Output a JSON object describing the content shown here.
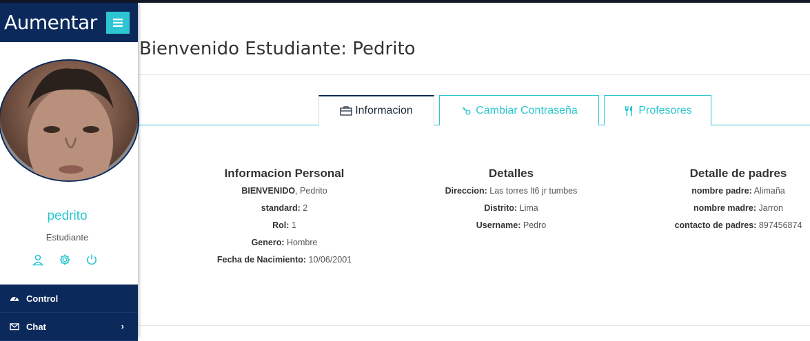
{
  "brand": {
    "name": "Aumentar"
  },
  "profile": {
    "name": "pedrito",
    "role": "Estudiante"
  },
  "nav": {
    "items": [
      {
        "label": "Control"
      },
      {
        "label": "Chat"
      }
    ]
  },
  "page": {
    "title": "Bienvenido Estudiante: Pedrito"
  },
  "tabs": [
    {
      "label": "Informacion",
      "active": true
    },
    {
      "label": "Cambiar Contraseña",
      "active": false
    },
    {
      "label": "Profesores",
      "active": false
    }
  ],
  "personal": {
    "heading": "Informacion Personal",
    "rows": [
      {
        "label": "BIENVENIDO",
        "value": ", Pedrito"
      },
      {
        "label": "standard:",
        "value": " 2"
      },
      {
        "label": "Rol:",
        "value": " 1"
      },
      {
        "label": "Genero:",
        "value": " Hombre"
      },
      {
        "label": "Fecha de Nacimiento:",
        "value": " 10/06/2001"
      }
    ]
  },
  "detalles": {
    "heading": "Detalles",
    "rows": [
      {
        "label": "Direccion:",
        "value": " Las torres lt6 jr tumbes"
      },
      {
        "label": "Distrito:",
        "value": " Lima"
      },
      {
        "label": "Username:",
        "value": " Pedro"
      }
    ]
  },
  "padres": {
    "heading": "Detalle de padres",
    "rows": [
      {
        "label": "nombre padre:",
        "value": " Alimaña"
      },
      {
        "label": "nombre madre:",
        "value": " Jarron"
      },
      {
        "label": "contacto de padres:",
        "value": " 897456874"
      }
    ]
  },
  "colors": {
    "navy": "#0b2a5b",
    "accent": "#2cc5d2"
  },
  "icons": {
    "menu": "hamburger-icon",
    "profile": [
      "user-icon",
      "gear-icon",
      "power-icon"
    ],
    "nav": [
      "dashboard-icon",
      "envelope-icon"
    ],
    "tabs": [
      "briefcase-icon",
      "key-icon",
      "utensils-icon"
    ]
  }
}
